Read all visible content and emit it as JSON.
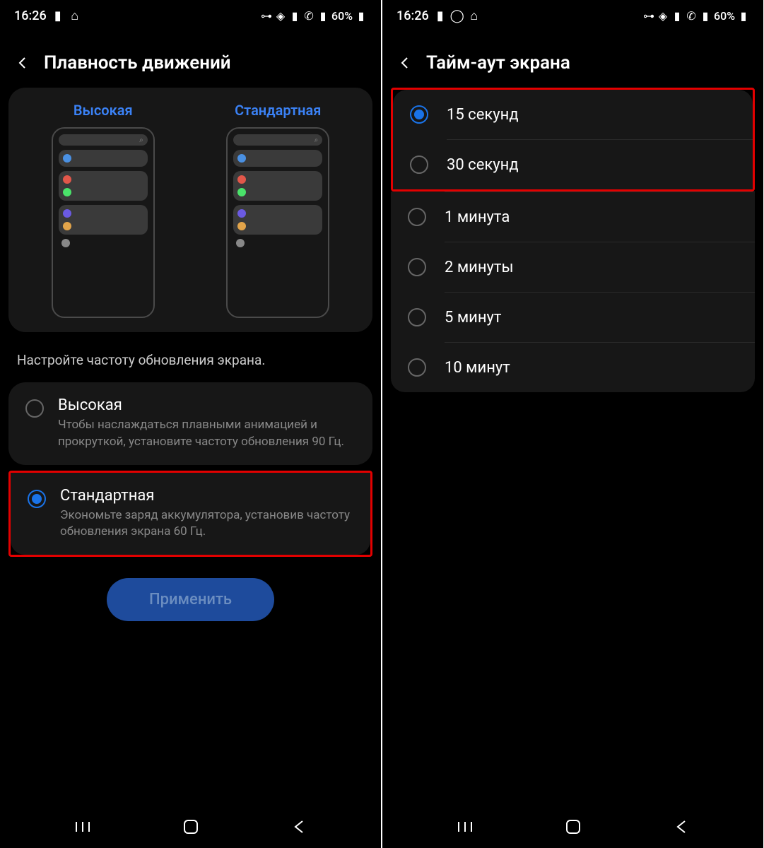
{
  "statusbar": {
    "time": "16:26",
    "battery": "60%"
  },
  "screen1": {
    "title": "Плавность движений",
    "preview": {
      "high_label": "Высокая",
      "standard_label": "Стандартная"
    },
    "description": "Настройте частоту обновления экрана.",
    "options": [
      {
        "title": "Высокая",
        "desc": "Чтобы наслаждаться плавными анимацией и прокруткой, установите частоту обновления 90 Гц.",
        "checked": false
      },
      {
        "title": "Стандартная",
        "desc": "Экономьте заряд аккумулятора, установив частоту обновления экрана 60 Гц.",
        "checked": true
      }
    ],
    "apply_button": "Применить"
  },
  "screen2": {
    "title": "Тайм-аут экрана",
    "options": [
      {
        "label": "15 секунд",
        "checked": true
      },
      {
        "label": "30 секунд",
        "checked": false
      },
      {
        "label": "1 минута",
        "checked": false
      },
      {
        "label": "2 минуты",
        "checked": false
      },
      {
        "label": "5 минут",
        "checked": false
      },
      {
        "label": "10 минут",
        "checked": false
      }
    ]
  }
}
